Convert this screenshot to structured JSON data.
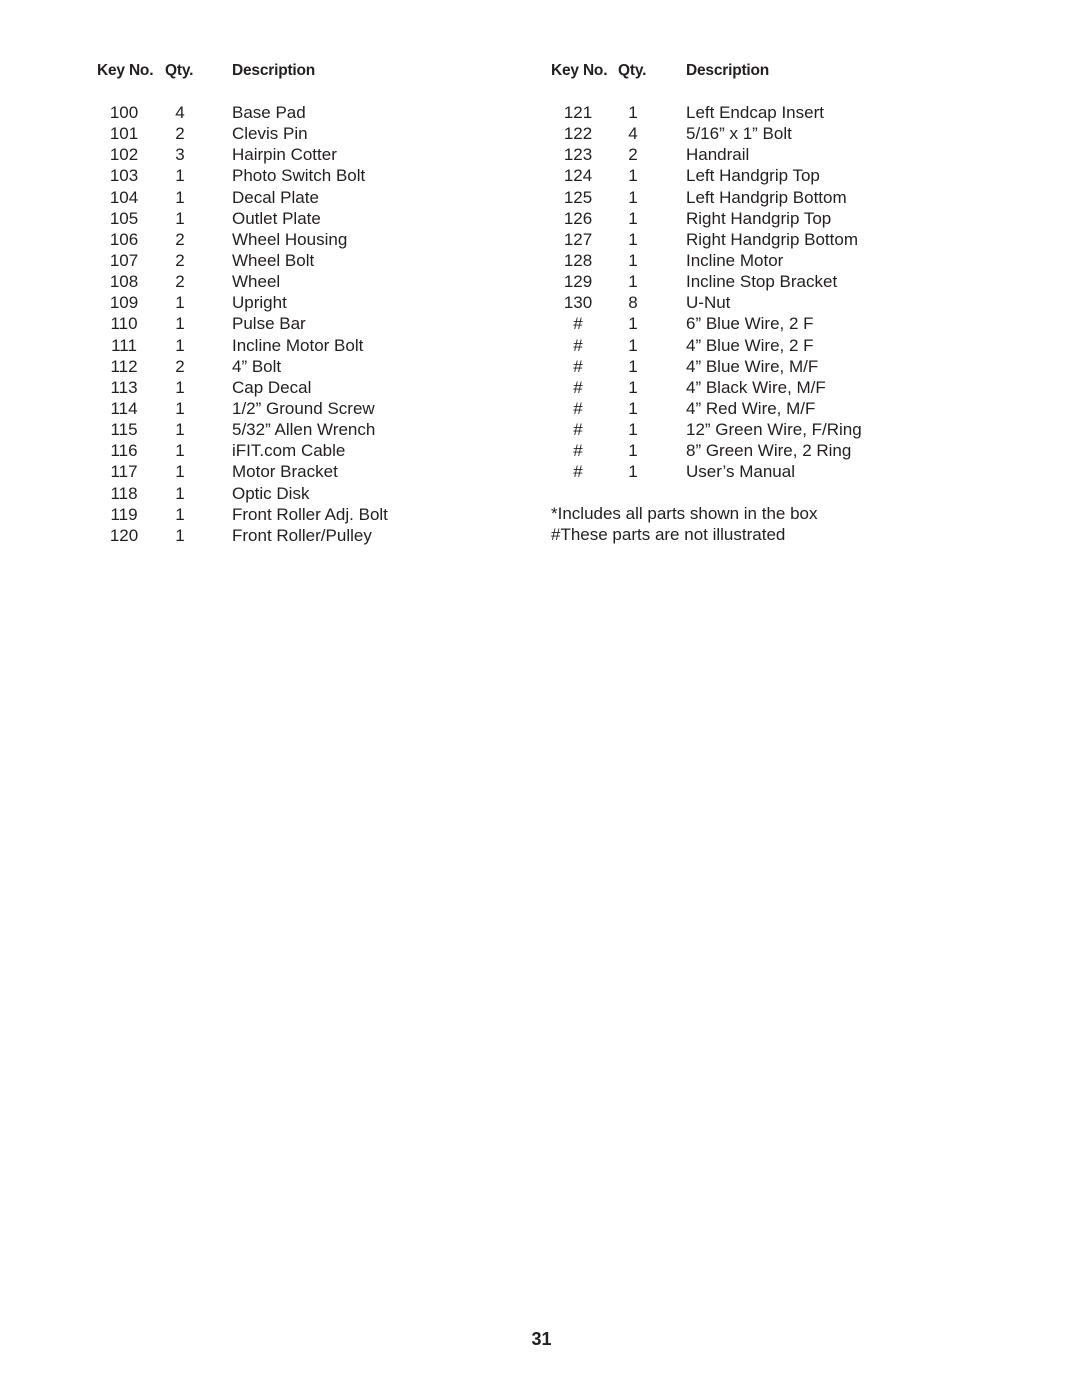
{
  "headers": {
    "key_no": "Key No.",
    "qty": "Qty.",
    "description": "Description"
  },
  "left_table": [
    {
      "key": "100",
      "qty": "4",
      "desc": "Base Pad"
    },
    {
      "key": "101",
      "qty": "2",
      "desc": "Clevis Pin"
    },
    {
      "key": "102",
      "qty": "3",
      "desc": "Hairpin Cotter"
    },
    {
      "key": "103",
      "qty": "1",
      "desc": "Photo Switch Bolt"
    },
    {
      "key": "104",
      "qty": "1",
      "desc": "Decal Plate"
    },
    {
      "key": "105",
      "qty": "1",
      "desc": "Outlet Plate"
    },
    {
      "key": "106",
      "qty": "2",
      "desc": "Wheel Housing"
    },
    {
      "key": "107",
      "qty": "2",
      "desc": "Wheel Bolt"
    },
    {
      "key": "108",
      "qty": "2",
      "desc": "Wheel"
    },
    {
      "key": "109",
      "qty": "1",
      "desc": "Upright"
    },
    {
      "key": "110",
      "qty": "1",
      "desc": "Pulse Bar"
    },
    {
      "key": "111",
      "qty": "1",
      "desc": "Incline Motor Bolt"
    },
    {
      "key": "112",
      "qty": "2",
      "desc": "4” Bolt"
    },
    {
      "key": "113",
      "qty": "1",
      "desc": "Cap Decal"
    },
    {
      "key": "114",
      "qty": "1",
      "desc": "1/2” Ground Screw"
    },
    {
      "key": "115",
      "qty": "1",
      "desc": "5/32” Allen Wrench"
    },
    {
      "key": "116",
      "qty": "1",
      "desc": "iFIT.com Cable"
    },
    {
      "key": "117",
      "qty": "1",
      "desc": "Motor Bracket"
    },
    {
      "key": "118",
      "qty": "1",
      "desc": "Optic Disk"
    },
    {
      "key": "119",
      "qty": "1",
      "desc": "Front Roller Adj. Bolt"
    },
    {
      "key": "120",
      "qty": "1",
      "desc": "Front Roller/Pulley"
    }
  ],
  "right_table": [
    {
      "key": "121",
      "qty": "1",
      "desc": "Left Endcap Insert"
    },
    {
      "key": "122",
      "qty": "4",
      "desc": "5/16” x 1” Bolt"
    },
    {
      "key": "123",
      "qty": "2",
      "desc": "Handrail"
    },
    {
      "key": "124",
      "qty": "1",
      "desc": "Left Handgrip Top"
    },
    {
      "key": "125",
      "qty": "1",
      "desc": "Left Handgrip Bottom"
    },
    {
      "key": "126",
      "qty": "1",
      "desc": "Right Handgrip Top"
    },
    {
      "key": "127",
      "qty": "1",
      "desc": "Right Handgrip Bottom"
    },
    {
      "key": "128",
      "qty": "1",
      "desc": "Incline Motor"
    },
    {
      "key": "129",
      "qty": "1",
      "desc": "Incline Stop Bracket"
    },
    {
      "key": "130",
      "qty": "8",
      "desc": "U-Nut"
    },
    {
      "key": "#",
      "qty": "1",
      "desc": "6” Blue Wire, 2 F"
    },
    {
      "key": "#",
      "qty": "1",
      "desc": "4” Blue Wire, 2 F"
    },
    {
      "key": "#",
      "qty": "1",
      "desc": "4” Blue Wire, M/F"
    },
    {
      "key": "#",
      "qty": "1",
      "desc": "4” Black Wire, M/F"
    },
    {
      "key": "#",
      "qty": "1",
      "desc": "4” Red Wire, M/F"
    },
    {
      "key": "#",
      "qty": "1",
      "desc": "12” Green Wire, F/Ring"
    },
    {
      "key": "#",
      "qty": "1",
      "desc": "8” Green Wire, 2 Ring"
    },
    {
      "key": "#",
      "qty": "1",
      "desc": "User’s Manual"
    }
  ],
  "notes": [
    "*Includes all parts shown in the box",
    "#These parts are not illustrated"
  ],
  "page_number": "31"
}
